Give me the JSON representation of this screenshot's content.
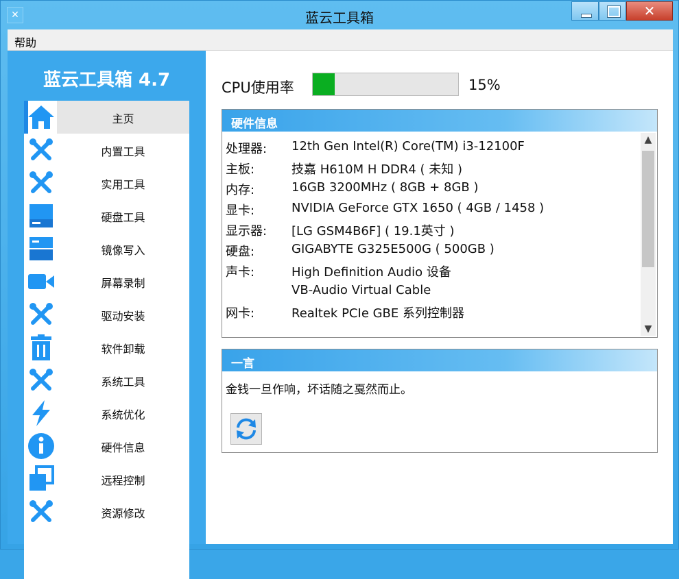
{
  "window": {
    "title": "蓝云工具箱",
    "close_glyph": "✕"
  },
  "menu": {
    "help": "帮助"
  },
  "sidebar": {
    "brand": "蓝云工具箱 4.7",
    "items": [
      {
        "label": "主页",
        "icon": "home-icon",
        "active": true
      },
      {
        "label": "内置工具",
        "icon": "tools-icon"
      },
      {
        "label": "实用工具",
        "icon": "tools-icon"
      },
      {
        "label": "硬盘工具",
        "icon": "hard-disk-icon"
      },
      {
        "label": "镜像写入",
        "icon": "drive-image-icon"
      },
      {
        "label": "屏幕录制",
        "icon": "video-camera-icon"
      },
      {
        "label": "驱动安装",
        "icon": "tools-icon"
      },
      {
        "label": "软件卸载",
        "icon": "trash-icon"
      },
      {
        "label": "系统工具",
        "icon": "tools-icon"
      },
      {
        "label": "系统优化",
        "icon": "lightning-icon"
      },
      {
        "label": "硬件信息",
        "icon": "info-icon"
      },
      {
        "label": "远程控制",
        "icon": "remote-windows-icon"
      },
      {
        "label": "资源修改",
        "icon": "tools-icon"
      }
    ]
  },
  "cpu": {
    "label": "CPU使用率",
    "percent_text": "15%",
    "percent": 15
  },
  "hardware": {
    "title": "硬件信息",
    "rows": [
      {
        "key": "处理器:",
        "value": "12th Gen Intel(R) Core(TM) i3-12100F"
      },
      {
        "key": "主板:",
        "value": "技嘉 H610M H DDR4 ( 未知 )"
      },
      {
        "key": "内存:",
        "value": "16GB 3200MHz ( 8GB + 8GB )"
      },
      {
        "key": "显卡:",
        "value": "NVIDIA GeForce GTX 1650 ( 4GB / 1458 )"
      },
      {
        "key": "显示器:",
        "value": " [LG GSM4B6F] ( 19.1英寸 )"
      },
      {
        "key": "硬盘:",
        "value": "GIGABYTE G325E500G ( 500GB )"
      },
      {
        "key": "声卡:",
        "value": "High Definition Audio 设备"
      },
      {
        "key": "",
        "value": "VB-Audio Virtual Cable"
      },
      {
        "key": "网卡:",
        "value": "Realtek PCIe GBE 系列控制器"
      }
    ]
  },
  "quote": {
    "title": "一言",
    "text": "金钱一旦作响，坏话随之戛然而止。"
  },
  "colors": {
    "accent": "#3ca8ec",
    "progress": "#0aae21",
    "close": "#c7402c"
  }
}
